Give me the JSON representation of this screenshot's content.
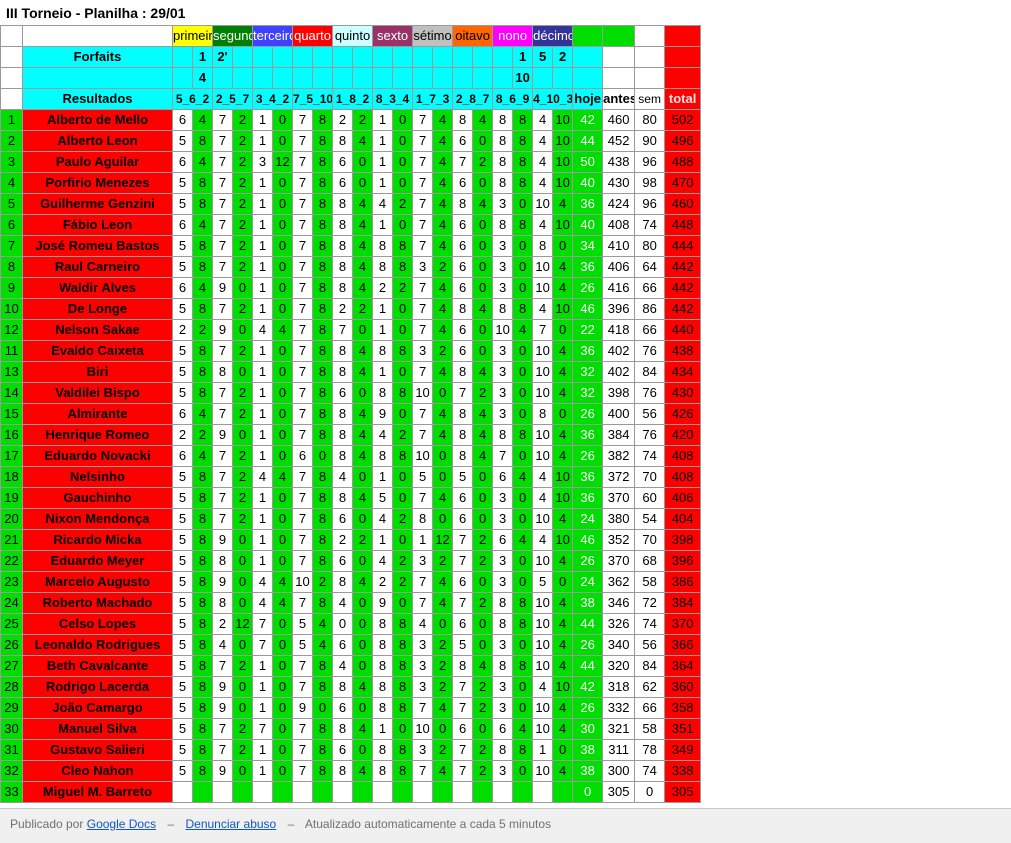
{
  "page": {
    "title": "III Torneio - Planilha : 29/01"
  },
  "colors": {
    "name_bg": "#ff0000",
    "green": "#00dd00",
    "cyan": "#00ffff",
    "total": "#ff0000",
    "round_colors": [
      "#ffff00",
      "#008000",
      "#4040ff",
      "#ff0000",
      "#ccffff",
      "#993366",
      "#c0c0c0",
      "#ff6600",
      "#ff00ff",
      "#333399"
    ]
  },
  "sheet": {
    "round_headers": [
      "primeiro",
      "segundo",
      "terceiro",
      "quarto",
      "quinto",
      "sexto",
      "sétimo",
      "oitavo",
      "nono",
      "décimo"
    ],
    "forfaits_label": "Forfaits",
    "resultados_label": "Resultados",
    "forfaits_row1": [
      "",
      "",
      "1",
      "2'",
      "",
      "",
      "",
      "",
      "",
      "",
      "",
      "",
      "",
      "",
      "",
      "",
      "",
      "",
      "1",
      "5",
      "2"
    ],
    "forfaits_row2": [
      "",
      "",
      "4",
      "",
      "",
      "",
      "",
      "",
      "",
      "",
      "",
      "",
      "",
      "",
      "",
      "",
      "",
      "",
      "10",
      "",
      ""
    ],
    "result_headers": [
      "5_6_2",
      "2_5_7",
      "3_4_2",
      "7_5_10",
      "1_8_2",
      "8_3_4",
      "1_7_3",
      "2_8_7",
      "8_6_9",
      "4_10_3"
    ],
    "hoje_label": "hoje",
    "antes_label": "antes",
    "sem_label": "sem",
    "total_label": "total",
    "rows": [
      {
        "n": "1",
        "name": "Alberto de Mello",
        "v": [
          "6",
          "4",
          "7",
          "2",
          "1",
          "0",
          "7",
          "8",
          "2",
          "2",
          "1",
          "0",
          "7",
          "4",
          "8",
          "4",
          "8",
          "8",
          "4",
          "10"
        ],
        "hoje": "42",
        "antes": "460",
        "sem": "80",
        "total": "502"
      },
      {
        "n": "2",
        "name": "Alberto Leon",
        "v": [
          "5",
          "8",
          "7",
          "2",
          "1",
          "0",
          "7",
          "8",
          "8",
          "4",
          "1",
          "0",
          "7",
          "4",
          "6",
          "0",
          "8",
          "8",
          "4",
          "10"
        ],
        "hoje": "44",
        "antes": "452",
        "sem": "90",
        "total": "496"
      },
      {
        "n": "3",
        "name": "Paulo Aguilar",
        "v": [
          "6",
          "4",
          "7",
          "2",
          "3",
          "12",
          "7",
          "8",
          "6",
          "0",
          "1",
          "0",
          "7",
          "4",
          "7",
          "2",
          "8",
          "8",
          "4",
          "10"
        ],
        "hoje": "50",
        "antes": "438",
        "sem": "96",
        "total": "488"
      },
      {
        "n": "4",
        "name": "Porfirio Menezes",
        "v": [
          "5",
          "8",
          "7",
          "2",
          "1",
          "0",
          "7",
          "8",
          "6",
          "0",
          "1",
          "0",
          "7",
          "4",
          "6",
          "0",
          "8",
          "8",
          "4",
          "10"
        ],
        "hoje": "40",
        "antes": "430",
        "sem": "98",
        "total": "470"
      },
      {
        "n": "5",
        "name": "Guilherme Genzini",
        "v": [
          "5",
          "8",
          "7",
          "2",
          "1",
          "0",
          "7",
          "8",
          "8",
          "4",
          "4",
          "2",
          "7",
          "4",
          "8",
          "4",
          "3",
          "0",
          "10",
          "4"
        ],
        "hoje": "36",
        "antes": "424",
        "sem": "96",
        "total": "460"
      },
      {
        "n": "6",
        "name": "Fábio Leon",
        "v": [
          "6",
          "4",
          "7",
          "2",
          "1",
          "0",
          "7",
          "8",
          "8",
          "4",
          "1",
          "0",
          "7",
          "4",
          "6",
          "0",
          "8",
          "8",
          "4",
          "10"
        ],
        "hoje": "40",
        "antes": "408",
        "sem": "74",
        "total": "448"
      },
      {
        "n": "7",
        "name": "José Romeu Bastos",
        "v": [
          "5",
          "8",
          "7",
          "2",
          "1",
          "0",
          "7",
          "8",
          "8",
          "4",
          "8",
          "8",
          "7",
          "4",
          "6",
          "0",
          "3",
          "0",
          "8",
          "0"
        ],
        "hoje": "34",
        "antes": "410",
        "sem": "80",
        "total": "444"
      },
      {
        "n": "8",
        "name": "Raul Carneiro",
        "v": [
          "5",
          "8",
          "7",
          "2",
          "1",
          "0",
          "7",
          "8",
          "8",
          "4",
          "8",
          "8",
          "3",
          "2",
          "6",
          "0",
          "3",
          "0",
          "10",
          "4"
        ],
        "hoje": "36",
        "antes": "406",
        "sem": "64",
        "total": "442"
      },
      {
        "n": "9",
        "name": "Waldir Alves",
        "v": [
          "6",
          "4",
          "9",
          "0",
          "1",
          "0",
          "7",
          "8",
          "8",
          "4",
          "2",
          "2",
          "7",
          "4",
          "6",
          "0",
          "3",
          "0",
          "10",
          "4"
        ],
        "hoje": "26",
        "antes": "416",
        "sem": "66",
        "total": "442"
      },
      {
        "n": "10",
        "name": "De Longe",
        "v": [
          "5",
          "8",
          "7",
          "2",
          "1",
          "0",
          "7",
          "8",
          "2",
          "2",
          "1",
          "0",
          "7",
          "4",
          "8",
          "4",
          "8",
          "8",
          "4",
          "10"
        ],
        "hoje": "46",
        "antes": "396",
        "sem": "86",
        "total": "442"
      },
      {
        "n": "12",
        "name": "Nelson Sakae",
        "v": [
          "2",
          "2",
          "9",
          "0",
          "4",
          "4",
          "7",
          "8",
          "7",
          "0",
          "1",
          "0",
          "7",
          "4",
          "6",
          "0",
          "10",
          "4",
          "7",
          "0"
        ],
        "hoje": "22",
        "antes": "418",
        "sem": "66",
        "total": "440"
      },
      {
        "n": "11",
        "name": "Evaldo Caixeta",
        "v": [
          "5",
          "8",
          "7",
          "2",
          "1",
          "0",
          "7",
          "8",
          "8",
          "4",
          "8",
          "8",
          "3",
          "2",
          "6",
          "0",
          "3",
          "0",
          "10",
          "4"
        ],
        "hoje": "36",
        "antes": "402",
        "sem": "76",
        "total": "438"
      },
      {
        "n": "13",
        "name": "Biri",
        "v": [
          "5",
          "8",
          "8",
          "0",
          "1",
          "0",
          "7",
          "8",
          "8",
          "4",
          "1",
          "0",
          "7",
          "4",
          "8",
          "4",
          "3",
          "0",
          "10",
          "4"
        ],
        "hoje": "32",
        "antes": "402",
        "sem": "84",
        "total": "434"
      },
      {
        "n": "14",
        "name": "Valdilei Bispo",
        "v": [
          "5",
          "8",
          "7",
          "2",
          "1",
          "0",
          "7",
          "8",
          "6",
          "0",
          "8",
          "8",
          "10",
          "0",
          "7",
          "2",
          "3",
          "0",
          "10",
          "4"
        ],
        "hoje": "32",
        "antes": "398",
        "sem": "76",
        "total": "430"
      },
      {
        "n": "15",
        "name": "Almirante",
        "v": [
          "6",
          "4",
          "7",
          "2",
          "1",
          "0",
          "7",
          "8",
          "8",
          "4",
          "9",
          "0",
          "7",
          "4",
          "8",
          "4",
          "3",
          "0",
          "8",
          "0"
        ],
        "hoje": "26",
        "antes": "400",
        "sem": "56",
        "total": "426"
      },
      {
        "n": "16",
        "name": "Henrique Romeo",
        "v": [
          "2",
          "2",
          "9",
          "0",
          "1",
          "0",
          "7",
          "8",
          "8",
          "4",
          "4",
          "2",
          "7",
          "4",
          "8",
          "4",
          "8",
          "8",
          "10",
          "4"
        ],
        "hoje": "36",
        "antes": "384",
        "sem": "76",
        "total": "420"
      },
      {
        "n": "17",
        "name": "Eduardo Novacki",
        "v": [
          "6",
          "4",
          "7",
          "2",
          "1",
          "0",
          "6",
          "0",
          "8",
          "4",
          "8",
          "8",
          "10",
          "0",
          "8",
          "4",
          "7",
          "0",
          "10",
          "4"
        ],
        "hoje": "26",
        "antes": "382",
        "sem": "74",
        "total": "408"
      },
      {
        "n": "18",
        "name": "Nelsinho",
        "v": [
          "5",
          "8",
          "7",
          "2",
          "4",
          "4",
          "7",
          "8",
          "4",
          "0",
          "1",
          "0",
          "5",
          "0",
          "5",
          "0",
          "6",
          "4",
          "4",
          "10"
        ],
        "hoje": "36",
        "antes": "372",
        "sem": "70",
        "total": "408"
      },
      {
        "n": "19",
        "name": "Gauchinho",
        "v": [
          "5",
          "8",
          "7",
          "2",
          "1",
          "0",
          "7",
          "8",
          "8",
          "4",
          "5",
          "0",
          "7",
          "4",
          "6",
          "0",
          "3",
          "0",
          "4",
          "10"
        ],
        "hoje": "36",
        "antes": "370",
        "sem": "60",
        "total": "406"
      },
      {
        "n": "20",
        "name": "Nixon Mendonça",
        "v": [
          "5",
          "8",
          "7",
          "2",
          "1",
          "0",
          "7",
          "8",
          "6",
          "0",
          "4",
          "2",
          "8",
          "0",
          "6",
          "0",
          "3",
          "0",
          "10",
          "4"
        ],
        "hoje": "24",
        "antes": "380",
        "sem": "54",
        "total": "404"
      },
      {
        "n": "21",
        "name": "Ricardo Micka",
        "v": [
          "5",
          "8",
          "9",
          "0",
          "1",
          "0",
          "7",
          "8",
          "2",
          "2",
          "1",
          "0",
          "1",
          "12",
          "7",
          "2",
          "6",
          "4",
          "4",
          "10"
        ],
        "hoje": "46",
        "antes": "352",
        "sem": "70",
        "total": "398"
      },
      {
        "n": "22",
        "name": "Eduardo Meyer",
        "v": [
          "5",
          "8",
          "8",
          "0",
          "1",
          "0",
          "7",
          "8",
          "6",
          "0",
          "4",
          "2",
          "3",
          "2",
          "7",
          "2",
          "3",
          "0",
          "10",
          "4"
        ],
        "hoje": "26",
        "antes": "370",
        "sem": "68",
        "total": "396"
      },
      {
        "n": "23",
        "name": "Marcelo Augusto",
        "v": [
          "5",
          "8",
          "9",
          "0",
          "4",
          "4",
          "10",
          "2",
          "8",
          "4",
          "2",
          "2",
          "7",
          "4",
          "6",
          "0",
          "3",
          "0",
          "5",
          "0"
        ],
        "hoje": "24",
        "antes": "362",
        "sem": "58",
        "total": "386"
      },
      {
        "n": "24",
        "name": "Roberto Machado",
        "v": [
          "5",
          "8",
          "8",
          "0",
          "4",
          "4",
          "7",
          "8",
          "4",
          "0",
          "9",
          "0",
          "7",
          "4",
          "7",
          "2",
          "8",
          "8",
          "10",
          "4"
        ],
        "hoje": "38",
        "antes": "346",
        "sem": "72",
        "total": "384"
      },
      {
        "n": "25",
        "name": "Celso Lopes",
        "v": [
          "5",
          "8",
          "2",
          "12",
          "7",
          "0",
          "5",
          "4",
          "0",
          "0",
          "8",
          "8",
          "4",
          "0",
          "6",
          "0",
          "8",
          "8",
          "10",
          "4"
        ],
        "hoje": "44",
        "antes": "326",
        "sem": "74",
        "total": "370"
      },
      {
        "n": "26",
        "name": "Leonaldo Rodrigues",
        "v": [
          "5",
          "8",
          "4",
          "0",
          "7",
          "0",
          "5",
          "4",
          "6",
          "0",
          "8",
          "8",
          "3",
          "2",
          "5",
          "0",
          "3",
          "0",
          "10",
          "4"
        ],
        "hoje": "26",
        "antes": "340",
        "sem": "56",
        "total": "366"
      },
      {
        "n": "27",
        "name": "Beth Cavalcante",
        "v": [
          "5",
          "8",
          "7",
          "2",
          "1",
          "0",
          "7",
          "8",
          "4",
          "0",
          "8",
          "8",
          "3",
          "2",
          "8",
          "4",
          "8",
          "8",
          "10",
          "4"
        ],
        "hoje": "44",
        "antes": "320",
        "sem": "84",
        "total": "364"
      },
      {
        "n": "28",
        "name": "Rodrigo Lacerda",
        "v": [
          "5",
          "8",
          "9",
          "0",
          "1",
          "0",
          "7",
          "8",
          "8",
          "4",
          "8",
          "8",
          "3",
          "2",
          "7",
          "2",
          "3",
          "0",
          "4",
          "10"
        ],
        "hoje": "42",
        "antes": "318",
        "sem": "62",
        "total": "360"
      },
      {
        "n": "29",
        "name": "João Camargo",
        "v": [
          "5",
          "8",
          "9",
          "0",
          "1",
          "0",
          "9",
          "0",
          "6",
          "0",
          "8",
          "8",
          "7",
          "4",
          "7",
          "2",
          "3",
          "0",
          "10",
          "4"
        ],
        "hoje": "26",
        "antes": "332",
        "sem": "66",
        "total": "358"
      },
      {
        "n": "30",
        "name": "Manuel Silva",
        "v": [
          "5",
          "8",
          "7",
          "2",
          "7",
          "0",
          "7",
          "8",
          "8",
          "4",
          "1",
          "0",
          "10",
          "0",
          "6",
          "0",
          "6",
          "4",
          "10",
          "4"
        ],
        "hoje": "30",
        "antes": "321",
        "sem": "58",
        "total": "351"
      },
      {
        "n": "31",
        "name": "Gustavo Salieri",
        "v": [
          "5",
          "8",
          "7",
          "2",
          "1",
          "0",
          "7",
          "8",
          "6",
          "0",
          "8",
          "8",
          "3",
          "2",
          "7",
          "2",
          "8",
          "8",
          "1",
          "0"
        ],
        "hoje": "38",
        "antes": "311",
        "sem": "78",
        "total": "349"
      },
      {
        "n": "32",
        "name": "Cleo Nahon",
        "v": [
          "5",
          "8",
          "9",
          "0",
          "1",
          "0",
          "7",
          "8",
          "8",
          "4",
          "8",
          "8",
          "7",
          "4",
          "7",
          "2",
          "3",
          "0",
          "10",
          "4"
        ],
        "hoje": "38",
        "antes": "300",
        "sem": "74",
        "total": "338"
      },
      {
        "n": "33",
        "name": "Miguel M. Barreto",
        "v": [
          "",
          "",
          "",
          "",
          "",
          "",
          "",
          "",
          "",
          "",
          "",
          "",
          "",
          "",
          "",
          "",
          "",
          "",
          "",
          ""
        ],
        "hoje": "0",
        "antes": "305",
        "sem": "0",
        "total": "305"
      }
    ]
  },
  "footer": {
    "published_by": "Publicado por",
    "google_docs_link": "Google Docs",
    "separator": "–",
    "report_abuse_link": "Denunciar abuso",
    "auto_update": "Atualizado automaticamente a cada 5 minutos"
  }
}
